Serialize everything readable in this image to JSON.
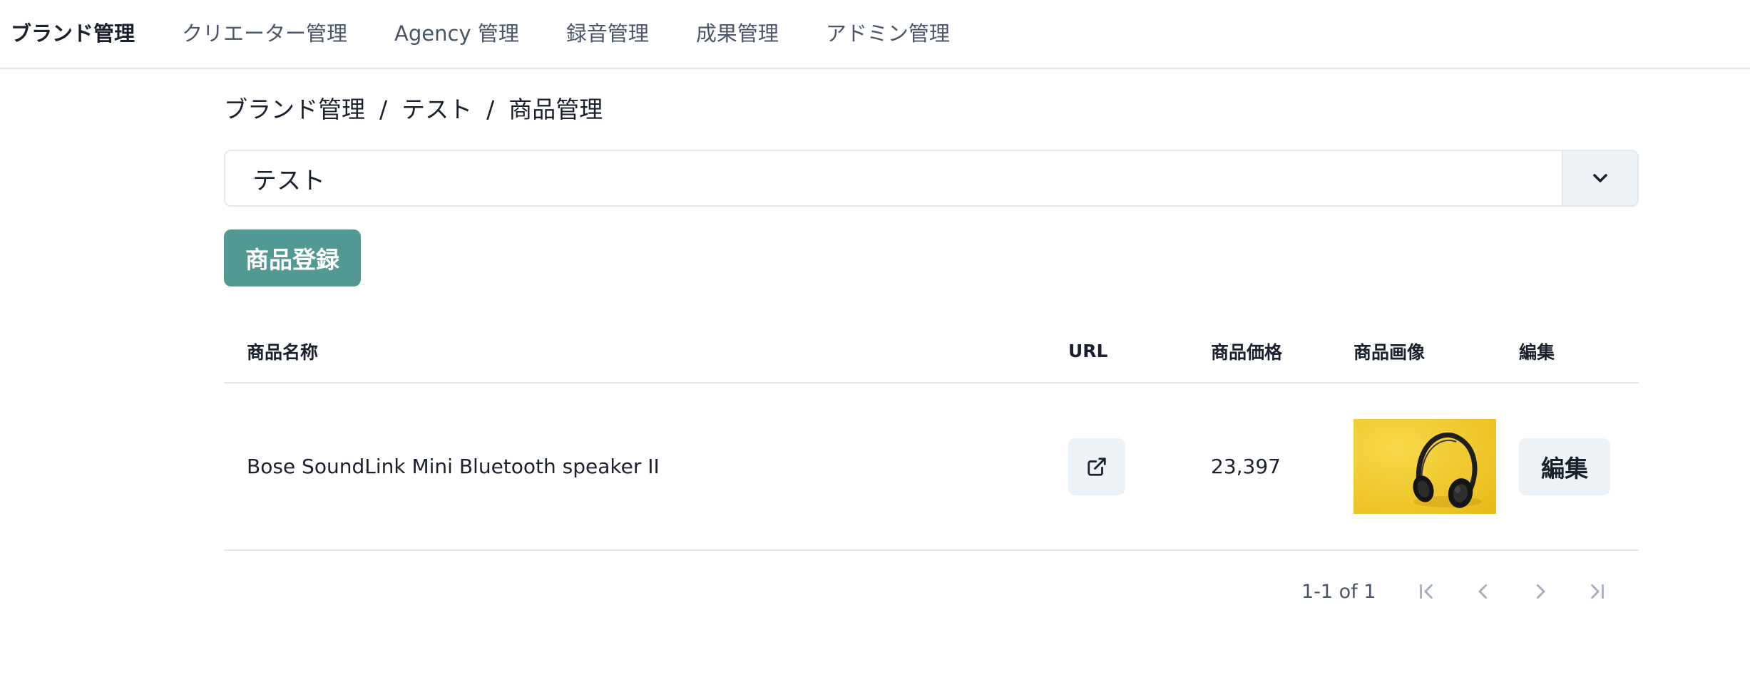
{
  "nav": {
    "items": [
      {
        "label": "ブランド管理",
        "active": true
      },
      {
        "label": "クリエーター管理",
        "active": false
      },
      {
        "label": "Agency 管理",
        "active": false
      },
      {
        "label": "録音管理",
        "active": false
      },
      {
        "label": "成果管理",
        "active": false
      },
      {
        "label": "アドミン管理",
        "active": false
      }
    ]
  },
  "breadcrumb": {
    "items": [
      "ブランド管理",
      "テスト",
      "商品管理"
    ],
    "separator": "/"
  },
  "brand_select": {
    "value": "テスト",
    "icon": "chevron-down-icon"
  },
  "register_button": {
    "label": "商品登録",
    "color": "#539993"
  },
  "table": {
    "headers": {
      "name": "商品名称",
      "url": "URL",
      "price": "商品価格",
      "image": "商品画像",
      "edit": "編集"
    },
    "rows": [
      {
        "name": "Bose SoundLink Mini Bluetooth speaker II",
        "url_icon": "external-link-icon",
        "price": "23,397",
        "image_icon": "headphones-product-image",
        "edit_label": "編集"
      }
    ]
  },
  "pagination": {
    "info": "1-1 of 1",
    "icons": [
      "first-page-icon",
      "previous-page-icon",
      "next-page-icon",
      "last-page-icon"
    ]
  }
}
